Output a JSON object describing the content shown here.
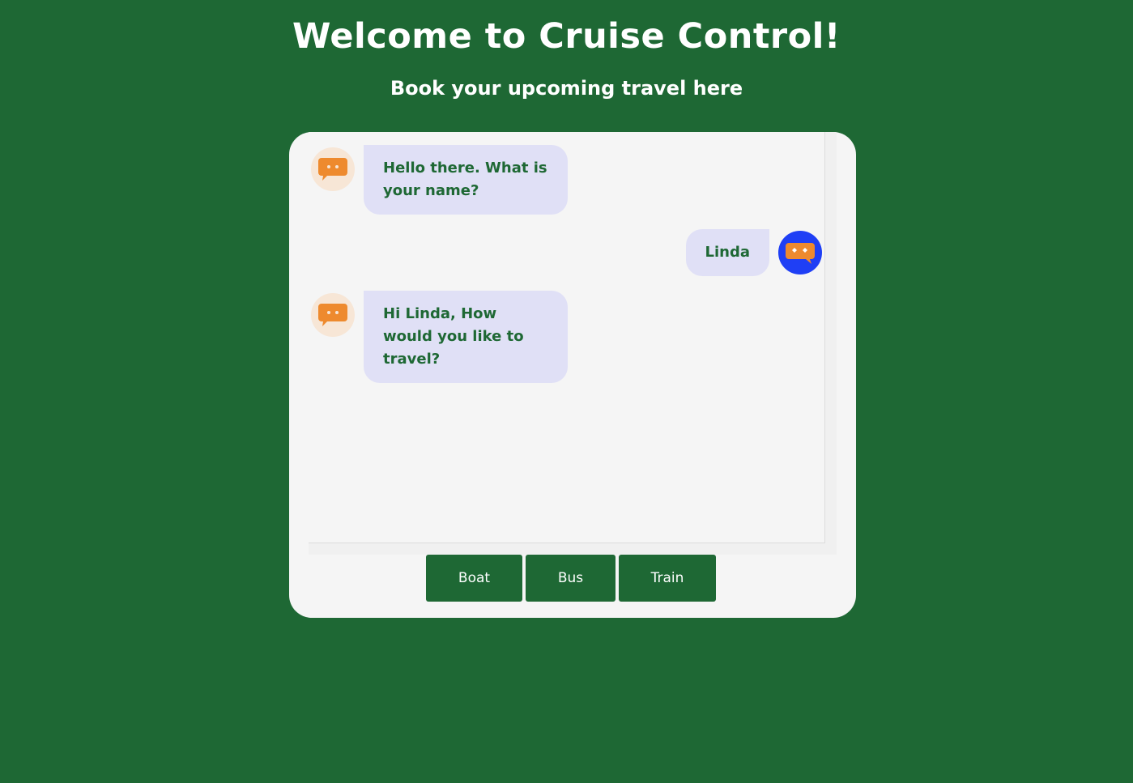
{
  "header": {
    "title": "Welcome to Cruise Control!",
    "subtitle": "Book your upcoming travel here"
  },
  "chat": {
    "messages": [
      {
        "sender": "bot",
        "text": "Hello there. What is your name?",
        "avatar_icon": "chat-bubble-icon"
      },
      {
        "sender": "user",
        "text": "Linda",
        "avatar_icon": "chat-bubble-icon"
      },
      {
        "sender": "bot",
        "text": "Hi Linda, How would you like to travel?",
        "avatar_icon": "chat-bubble-icon"
      }
    ]
  },
  "options": {
    "buttons": [
      {
        "label": "Boat"
      },
      {
        "label": "Bus"
      },
      {
        "label": "Train"
      }
    ]
  },
  "colors": {
    "background": "#1e6834",
    "card": "#f5f5f5",
    "bubble": "#e0e0f6",
    "bubble_text": "#1e6834",
    "bot_avatar_bg": "#f7e6d6",
    "user_avatar_bg": "#1f3ff5",
    "icon_orange": "#ee8a2e"
  }
}
